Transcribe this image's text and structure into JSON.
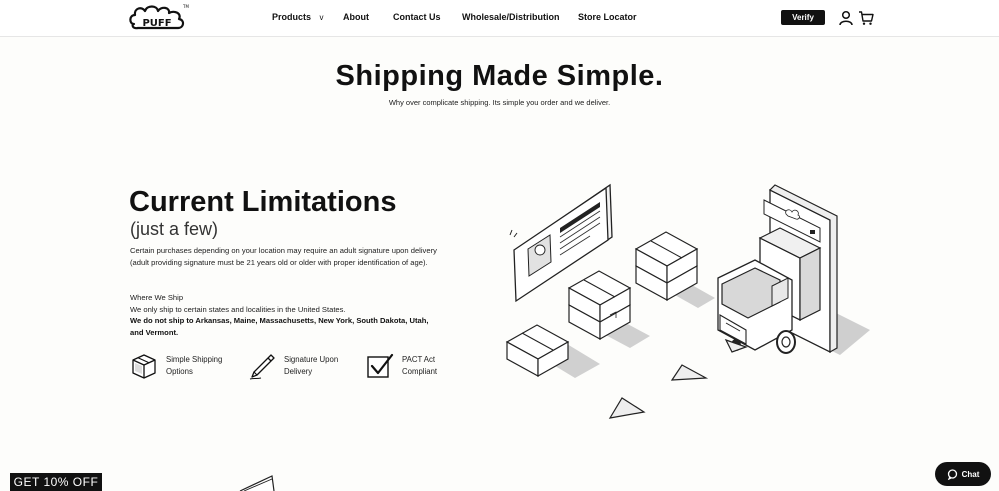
{
  "header": {
    "logo_text": "PUFF",
    "nav": [
      {
        "label": "Products",
        "has_dropdown": true,
        "caret": "v"
      },
      {
        "label": "About"
      },
      {
        "label": "Contact Us"
      },
      {
        "label": "Wholesale/Distribution"
      },
      {
        "label": "Store Locator"
      }
    ],
    "verify_label": "Verify",
    "icons": [
      "user-icon",
      "cart-icon"
    ]
  },
  "hero": {
    "title": "Shipping Made Simple.",
    "subtitle": "Why over complicate shipping. Its simple you order and we deliver."
  },
  "limitations": {
    "title": "Current Limitations",
    "subtitle": "(just a few)",
    "description": "Certain purchases depending on your location may require an adult signature upon delivery (adult providing signature must be 21 years old or older with proper identification of age).",
    "where_heading": "Where We Ship",
    "where_text": "We only ship to certain states and localities in the United States.",
    "no_ship_text": "We do not ship to Arkansas, Maine, Massachusetts, New York, South Dakota, Utah, and Vermont."
  },
  "features": [
    {
      "line1": "Simple Shipping",
      "line2": "Options",
      "icon": "box-icon"
    },
    {
      "line1": "Signature Upon",
      "line2": "Delivery",
      "icon": "pen-icon"
    },
    {
      "line1": "PACT Act",
      "line2": "Compliant",
      "icon": "checkbox-icon"
    }
  ],
  "promo_label": "GET 10% OFF",
  "chat_label": "Chat",
  "colors": {
    "accent": "#111111",
    "background": "#fdfdfb",
    "shadow_gray": "#cfcfcf"
  }
}
